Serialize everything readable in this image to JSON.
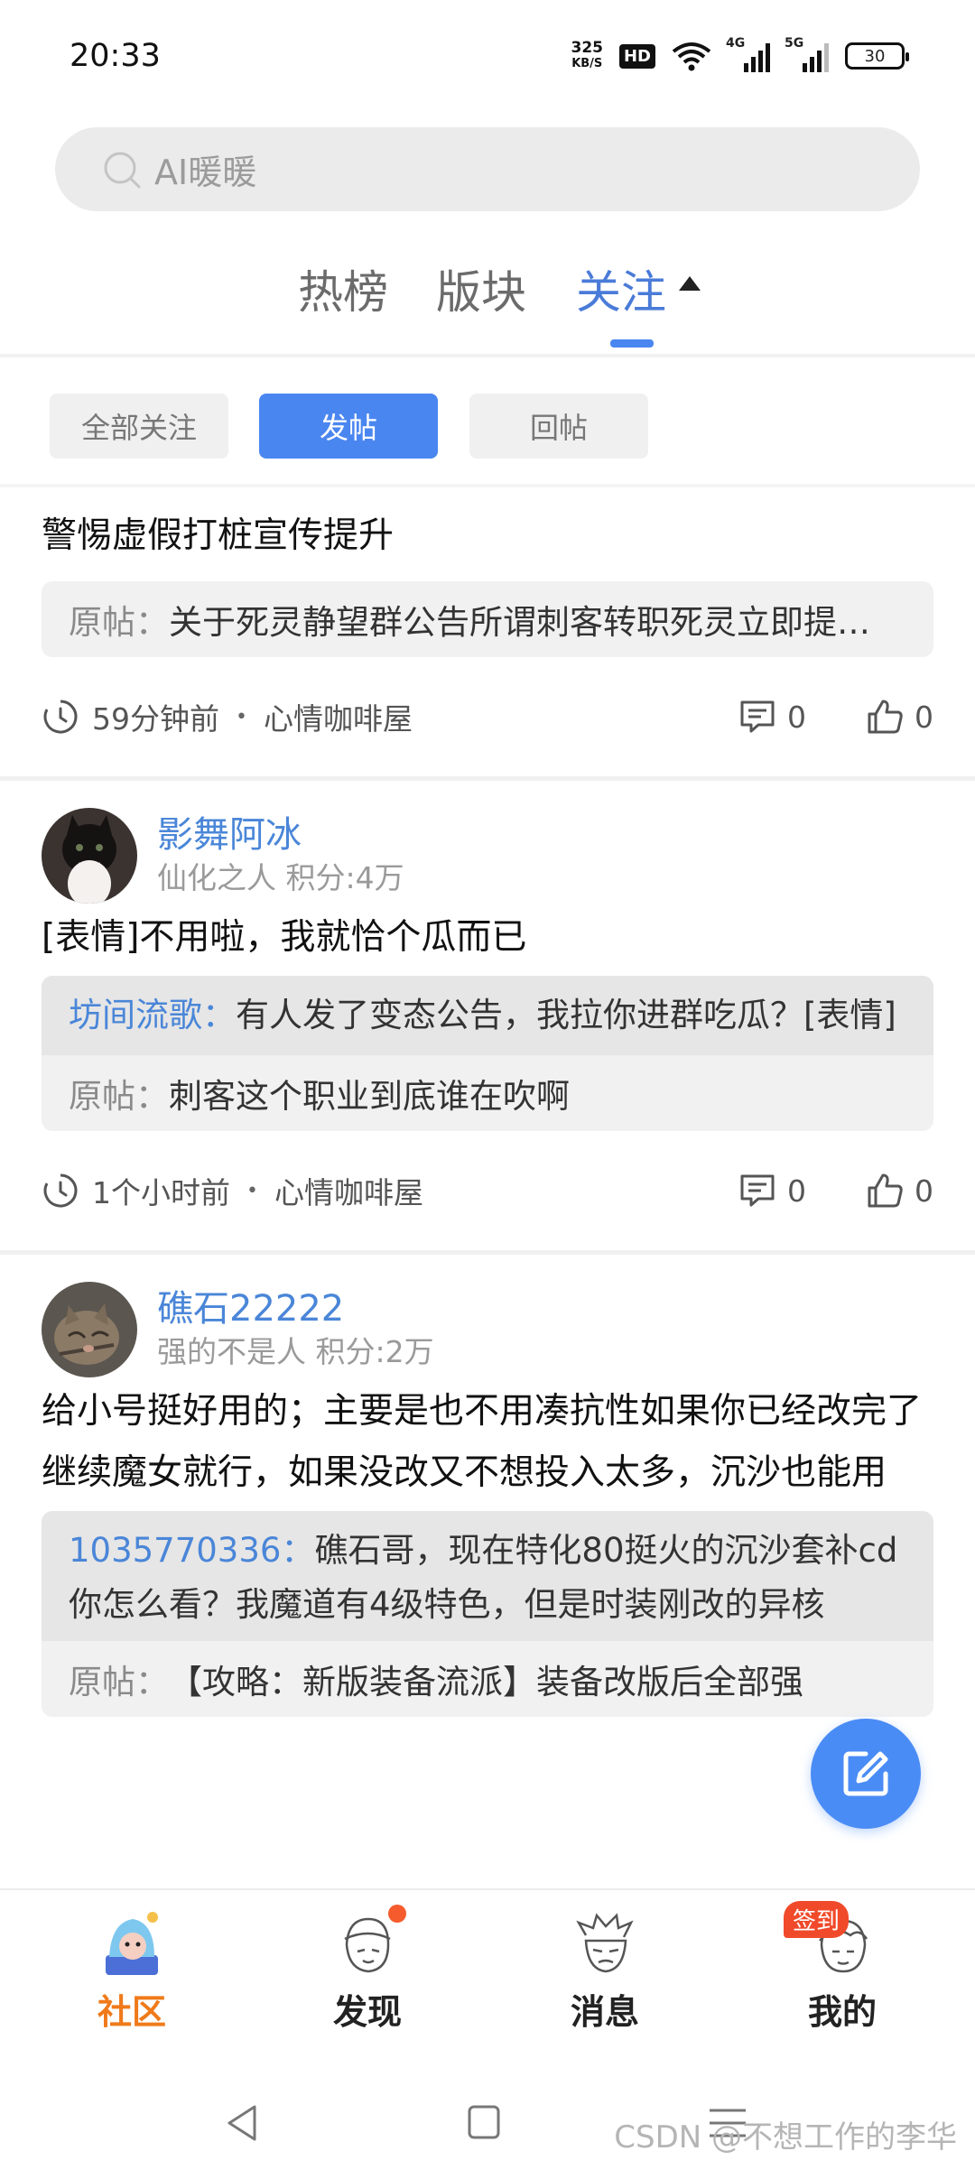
{
  "status_bar": {
    "time": "20:33",
    "net_speed_value": "325",
    "net_speed_unit": "KB/S",
    "hd_label": "HD",
    "signal1_label": "4G",
    "signal2_label": "5G",
    "battery": "30"
  },
  "search": {
    "placeholder": "AI暖暖"
  },
  "top_tabs": [
    {
      "label": "热榜"
    },
    {
      "label": "版块"
    },
    {
      "label": "关注"
    }
  ],
  "filters": [
    {
      "label": "全部关注"
    },
    {
      "label": "发帖"
    },
    {
      "label": "回帖"
    }
  ],
  "posts": [
    {
      "text": "警惕虚假打桩宣传提升",
      "orig_prefix": "原帖：",
      "orig_text": "关于死灵静望群公告所谓刺客转职死灵立即提…",
      "time": "59分钟前",
      "board": "心情咖啡屋",
      "comments": "0",
      "likes": "0"
    },
    {
      "author": "影舞阿冰",
      "meta": "仙化之人 积分:4万",
      "text": "[表情]不用啦，我就恰个瓜而已",
      "reply_name": "坊间流歌：",
      "reply_text": "有人发了变态公告，我拉你进群吃瓜？[表情]",
      "orig_prefix": "原帖：",
      "orig_text": "刺客这个职业到底谁在吹啊",
      "time": "1个小时前",
      "board": "心情咖啡屋",
      "comments": "0",
      "likes": "0"
    },
    {
      "author": "礁石22222",
      "meta": "强的不是人 积分:2万",
      "text": "给小号挺好用的；主要是也不用凑抗性如果你已经改完了继续魔女就行，如果没改又不想投入太多，沉沙也能用",
      "reply_name": "1035770336：",
      "reply_text": "礁石哥，现在特化80挺火的沉沙套补cd你怎么看？我魔道有4级特色，但是时装刚改的异核",
      "orig_prefix": "原帖：",
      "orig_text": "【攻略：新版装备流派】装备改版后全部强"
    }
  ],
  "bottom_nav": [
    {
      "label": "社区"
    },
    {
      "label": "发现"
    },
    {
      "label": "消息"
    },
    {
      "label": "我的",
      "badge": "签到"
    }
  ],
  "watermark": "CSDN @不想工作的李华",
  "colors": {
    "accent": "#4a86f0",
    "active_nav": "#f07a1a",
    "link": "#4a86d8"
  }
}
